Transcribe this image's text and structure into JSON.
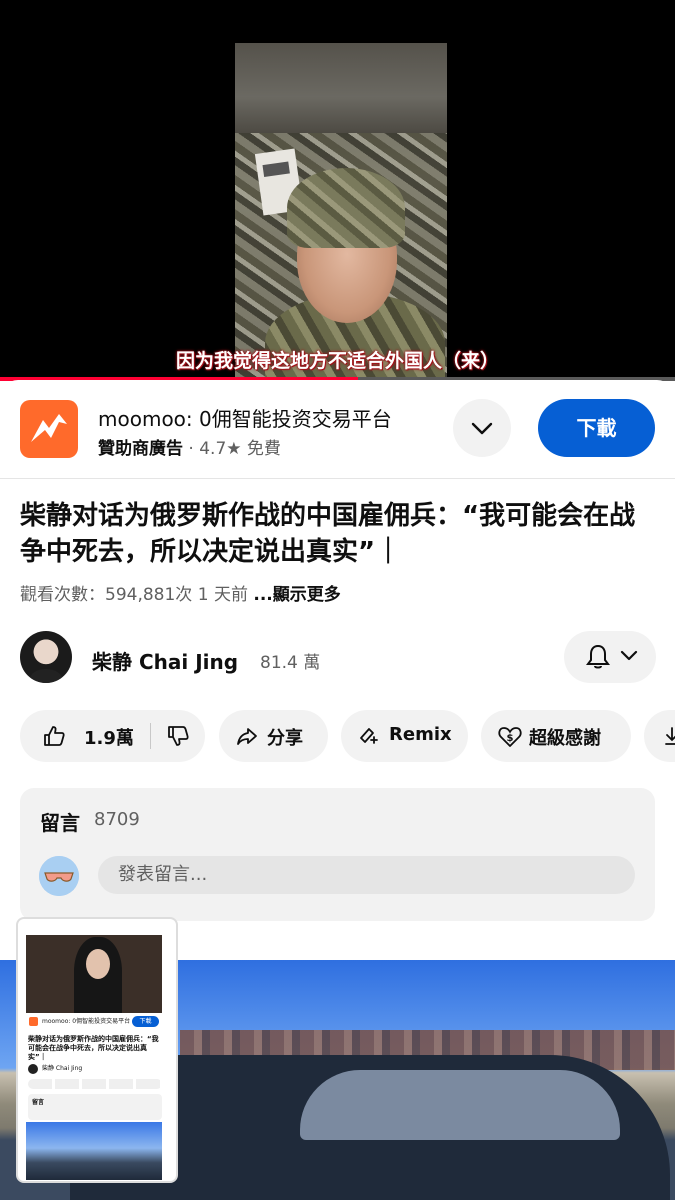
{
  "player": {
    "subtitle": "因为我觉得这地方不适合外国人（来）",
    "progress": 0.53,
    "accent_color": "#ff0033"
  },
  "ad": {
    "logo_icon": "moomoo-bull-logo",
    "title": "moomoo: 0佣智能投资交易平台",
    "sponsor_label": "贊助商廣告",
    "rating": "4.7★",
    "price": "免費",
    "expand_icon": "chevron-down-icon",
    "download_label": "下載",
    "download_color": "#065fd4"
  },
  "video": {
    "title": "柴静对话为俄罗斯作战的中国雇佣兵：“我可能会在战争中死去，所以决定说出真实”｜",
    "views": "觀看次數：594,881次",
    "age": "1 天前",
    "more_label": "...顯示更多"
  },
  "channel": {
    "name": "柴静 Chai Jing",
    "subscribers": "81.4 萬",
    "bell_icon": "bell-icon"
  },
  "actions": {
    "like_count": "1.9萬",
    "share_label": "分享",
    "remix_label": "Remix",
    "thanks_label": "超級感謝"
  },
  "comments": {
    "title": "留言",
    "count": "8709",
    "placeholder": "發表留言..."
  },
  "pip": {
    "ad_text": "moomoo: 0佣智能投资交易平台",
    "download_label": "下載",
    "title": "柴静对话为俄罗斯作战的中国雇佣兵：“我可能会在战争中死去，所以决定说出真实”｜",
    "channel": "柴静 Chai Jing",
    "comments_title": "留言"
  }
}
